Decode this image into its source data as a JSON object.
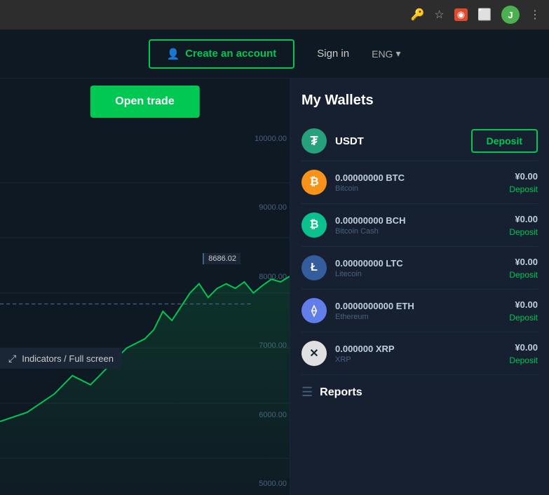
{
  "browser": {
    "avatar_letter": "J"
  },
  "header": {
    "create_account_label": "Create an account",
    "signin_label": "Sign in",
    "lang_label": "ENG"
  },
  "chart": {
    "open_trade_label": "Open trade",
    "indicators_label": "Indicators / Full screen",
    "price_callout": "8686.02",
    "y_labels": [
      "10000.00",
      "9000.00",
      "8000.00",
      "7000.00",
      "6000.00",
      "5000.00"
    ]
  },
  "wallets": {
    "title": "My Wallets",
    "usdt": {
      "symbol": "₮",
      "label": "USDT",
      "deposit_label": "Deposit"
    },
    "coins": [
      {
        "symbol": "₿",
        "css_class": "btc",
        "amount": "0.00000000 BTC",
        "name": "Bitcoin",
        "fiat": "¥0.00",
        "deposit": "Deposit"
      },
      {
        "symbol": "₿",
        "css_class": "bch",
        "amount": "0.00000000 BCH",
        "name": "Bitcoin Cash",
        "fiat": "¥0.00",
        "deposit": "Deposit"
      },
      {
        "symbol": "Ł",
        "css_class": "ltc",
        "amount": "0.00000000 LTC",
        "name": "Litecoin",
        "fiat": "¥0.00",
        "deposit": "Deposit"
      },
      {
        "symbol": "⟠",
        "css_class": "eth",
        "amount": "0.0000000000 ETH",
        "name": "Ethereum",
        "fiat": "¥0.00",
        "deposit": "Deposit"
      },
      {
        "symbol": "✕",
        "css_class": "xrp",
        "amount": "0.000000 XRP",
        "name": "XRP",
        "fiat": "¥0.00",
        "deposit": "Deposit"
      }
    ],
    "reports_label": "Reports"
  }
}
